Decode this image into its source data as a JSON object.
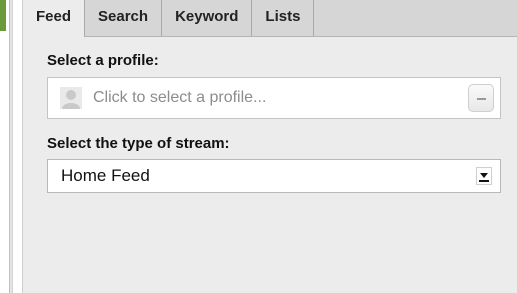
{
  "tabs": [
    {
      "label": "Feed",
      "active": true
    },
    {
      "label": "Search",
      "active": false
    },
    {
      "label": "Keyword",
      "active": false
    },
    {
      "label": "Lists",
      "active": false
    }
  ],
  "profile": {
    "label": "Select a profile:",
    "placeholder": "Click to select a profile...",
    "avatar_icon": "user-silhouette-icon"
  },
  "stream": {
    "label": "Select the type of stream:",
    "selected": "Home Feed"
  },
  "colors": {
    "accent_green": "#6b9a3c",
    "panel_bg": "#ececec",
    "tabbar_bg": "#d6d6d6"
  }
}
